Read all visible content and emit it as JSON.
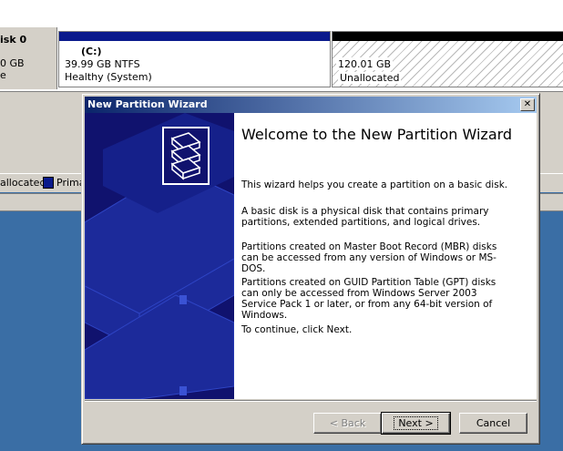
{
  "disk": {
    "label": "isk 0",
    "size": "0 GB",
    "state": "e",
    "partition_c": {
      "name": "(C:)",
      "size": "39.99 GB NTFS",
      "status": "Healthy (System)"
    },
    "unallocated": {
      "size": "120.01 GB",
      "status": "Unallocated"
    }
  },
  "legend": {
    "unallocated": "allocated",
    "primary": "Prima"
  },
  "colors": {
    "primary_partition": "#0a1a8c",
    "desktop": "#3a6ea5",
    "wizard_side": "#10126e"
  },
  "dialog": {
    "title": "New Partition Wizard",
    "close_icon": "close-icon",
    "heading": "Welcome to the New Partition Wizard",
    "paragraphs": [
      "This wizard helps you create a partition on a basic disk.",
      "A basic disk is a physical disk that contains primary partitions, extended partitions, and logical drives.",
      "Partitions created on Master Boot Record (MBR) disks can be accessed from any version of Windows or MS-DOS.",
      "Partitions created on GUID Partition Table (GPT) disks can only be accessed from Windows Server 2003 Service Pack 1 or later, or from any 64-bit version of Windows.",
      "To continue, click Next."
    ],
    "buttons": {
      "back": "< Back",
      "next": "Next >",
      "cancel": "Cancel"
    }
  }
}
